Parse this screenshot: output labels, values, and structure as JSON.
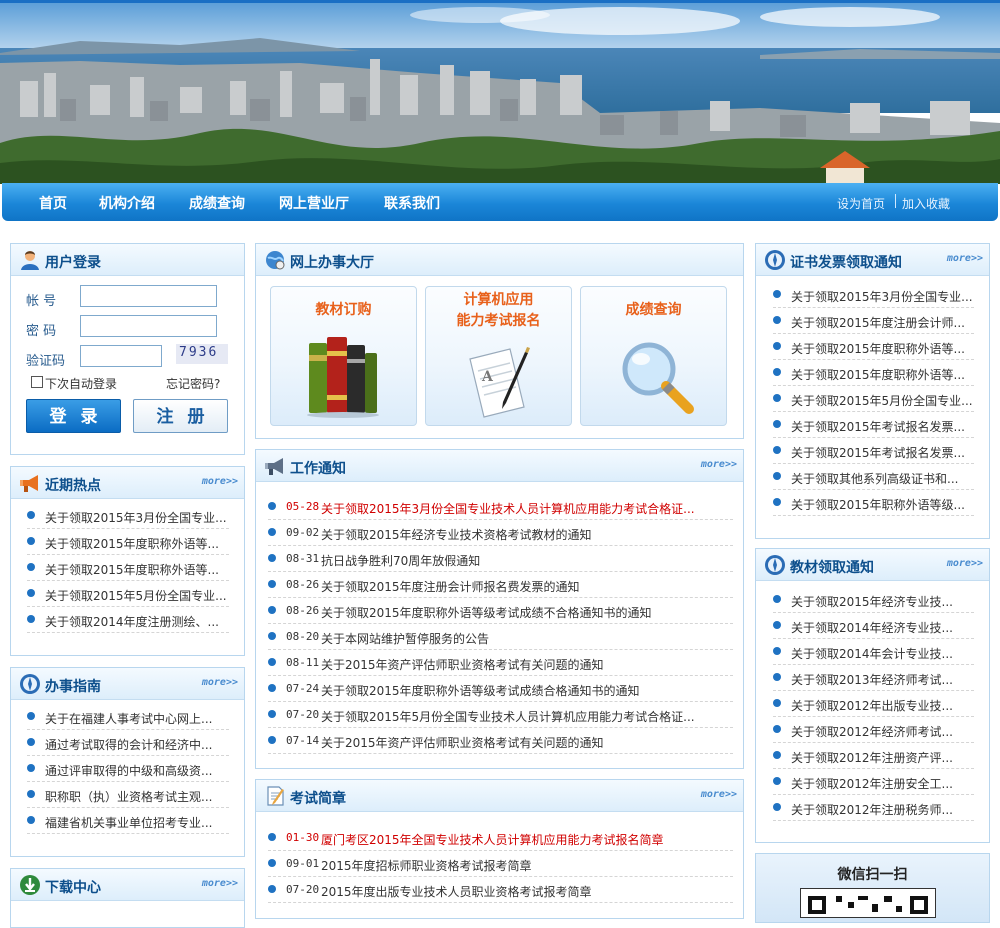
{
  "nav": {
    "items": [
      "首页",
      "机构介绍",
      "成绩查询",
      "网上营业厅",
      "联系我们"
    ],
    "set_home": "设为首页",
    "favorite": "加入收藏"
  },
  "login": {
    "title": "用户登录",
    "account_label": "帐 号",
    "password_label": "密 码",
    "captcha_label": "验证码",
    "captcha_value": "7936",
    "remember": "下次自动登录",
    "forgot": "忘记密码?",
    "login_button": "登录",
    "register_button": "注册"
  },
  "hot": {
    "title": "近期热点",
    "more": "more>>",
    "items": [
      "关于领取2015年3月份全国专业...",
      "关于领取2015年度职称外语等...",
      "关于领取2015年度职称外语等...",
      "关于领取2015年5月份全国专业...",
      "关于领取2014年度注册测绘、..."
    ]
  },
  "guide": {
    "title": "办事指南",
    "more": "more>>",
    "items": [
      "关于在福建人事考试中心网上...",
      "通过考试取得的会计和经济中...",
      "通过评审取得的中级和高级资...",
      "职称职（执）业资格考试主观...",
      "福建省机关事业单位招考专业..."
    ]
  },
  "download": {
    "title": "下载中心",
    "more": "more>>"
  },
  "hall": {
    "title": "网上办事大厅",
    "cards": [
      {
        "title": "教材订购"
      },
      {
        "title": "计算机应用",
        "title2": "能力考试报名"
      },
      {
        "title": "成绩查询"
      }
    ]
  },
  "work": {
    "title": "工作通知",
    "more": "more>>",
    "items": [
      {
        "date": "05-28",
        "text": "关于领取2015年3月份全国专业技术人员计算机应用能力考试合格证...",
        "highlight": true
      },
      {
        "date": "09-02",
        "text": "关于领取2015年经济专业技术资格考试教材的通知"
      },
      {
        "date": "08-31",
        "text": "抗日战争胜利70周年放假通知"
      },
      {
        "date": "08-26",
        "text": "关于领取2015年度注册会计师报名费发票的通知"
      },
      {
        "date": "08-26",
        "text": "关于领取2015年度职称外语等级考试成绩不合格通知书的通知"
      },
      {
        "date": "08-20",
        "text": "关于本网站维护暂停服务的公告"
      },
      {
        "date": "08-11",
        "text": "关于2015年资产评估师职业资格考试有关问题的通知"
      },
      {
        "date": "07-24",
        "text": "关于领取2015年度职称外语等级考试成绩合格通知书的通知"
      },
      {
        "date": "07-20",
        "text": "关于领取2015年5月份全国专业技术人员计算机应用能力考试合格证..."
      },
      {
        "date": "07-14",
        "text": "关于2015年资产评估师职业资格考试有关问题的通知"
      }
    ]
  },
  "exam": {
    "title": "考试简章",
    "more": "more>>",
    "items": [
      {
        "date": "01-30",
        "text": "厦门考区2015年全国专业技术人员计算机应用能力考试报名简章",
        "highlight": true
      },
      {
        "date": "09-01",
        "text": "2015年度招标师职业资格考试报考简章"
      },
      {
        "date": "07-20",
        "text": "2015年度出版专业技术人员职业资格考试报考简章"
      }
    ]
  },
  "cert": {
    "title": "证书发票领取通知",
    "more": "more>>",
    "items": [
      "关于领取2015年3月份全国专业...",
      "关于领取2015年度注册会计师...",
      "关于领取2015年度职称外语等...",
      "关于领取2015年度职称外语等...",
      "关于领取2015年5月份全国专业...",
      "关于领取2015年考试报名发票...",
      "关于领取2015年考试报名发票...",
      "关于领取其他系列高级证书和...",
      "关于领取2015年职称外语等级..."
    ]
  },
  "textbook": {
    "title": "教材领取通知",
    "more": "more>>",
    "items": [
      "关于领取2015年经济专业技...",
      "关于领取2014年经济专业技...",
      "关于领取2014年会计专业技...",
      "关于领取2013年经济师考试...",
      "关于领取2012年出版专业技...",
      "关于领取2012年经济师考试...",
      "关于领取2012年注册资产评...",
      "关于领取2012年注册安全工...",
      "关于领取2012年注册税务师..."
    ]
  },
  "wechat": {
    "title": "微信扫一扫"
  },
  "colors": {
    "nav": "#1b86d8",
    "panel_title": "#0d4f8c",
    "card_title": "#e8611b",
    "highlight": "#d00000",
    "bullet": "#1f72c2"
  }
}
